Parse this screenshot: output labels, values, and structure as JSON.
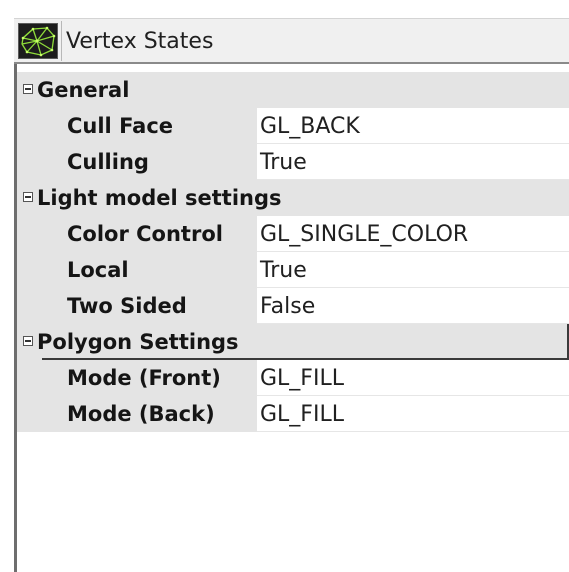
{
  "window": {
    "title": "Vertex States",
    "icon": "wireframe-mesh-icon"
  },
  "groups": [
    {
      "label": "General",
      "expanded": true,
      "properties": [
        {
          "name": "Cull Face",
          "value": "GL_BACK"
        },
        {
          "name": "Culling",
          "value": "True"
        }
      ]
    },
    {
      "label": "Light model settings",
      "expanded": true,
      "properties": [
        {
          "name": "Color Control",
          "value": "GL_SINGLE_COLOR"
        },
        {
          "name": "Local",
          "value": "True"
        },
        {
          "name": "Two Sided",
          "value": "False"
        }
      ]
    },
    {
      "label": "Polygon Settings",
      "expanded": true,
      "selected": true,
      "properties": [
        {
          "name": "Mode (Front)",
          "value": "GL_FILL"
        },
        {
          "name": "Mode (Back)",
          "value": "GL_FILL"
        }
      ]
    }
  ],
  "colors": {
    "group_background": "#e4e4e4",
    "icon_background": "#1c1c1c",
    "icon_mesh": "#8fdc3a"
  }
}
